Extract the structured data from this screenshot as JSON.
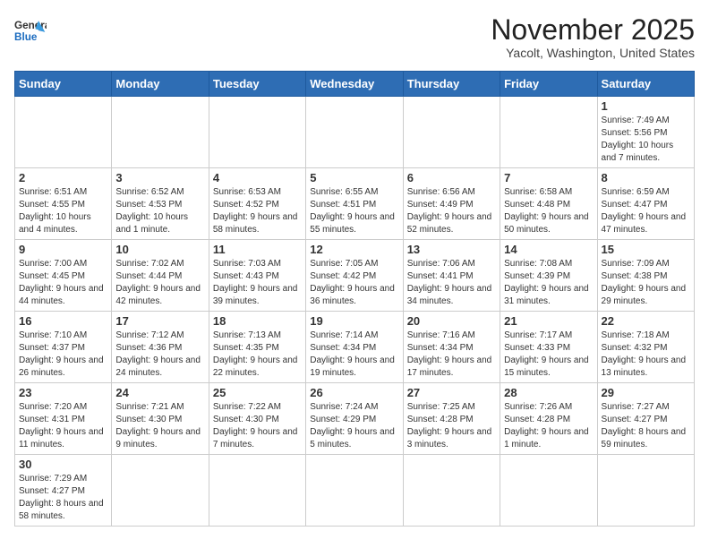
{
  "header": {
    "logo_general": "General",
    "logo_blue": "Blue",
    "month": "November 2025",
    "location": "Yacolt, Washington, United States"
  },
  "weekdays": [
    "Sunday",
    "Monday",
    "Tuesday",
    "Wednesday",
    "Thursday",
    "Friday",
    "Saturday"
  ],
  "weeks": [
    [
      {
        "day": "",
        "info": ""
      },
      {
        "day": "",
        "info": ""
      },
      {
        "day": "",
        "info": ""
      },
      {
        "day": "",
        "info": ""
      },
      {
        "day": "",
        "info": ""
      },
      {
        "day": "",
        "info": ""
      },
      {
        "day": "1",
        "info": "Sunrise: 7:49 AM\nSunset: 5:56 PM\nDaylight: 10 hours and 7 minutes."
      }
    ],
    [
      {
        "day": "2",
        "info": "Sunrise: 6:51 AM\nSunset: 4:55 PM\nDaylight: 10 hours and 4 minutes."
      },
      {
        "day": "3",
        "info": "Sunrise: 6:52 AM\nSunset: 4:53 PM\nDaylight: 10 hours and 1 minute."
      },
      {
        "day": "4",
        "info": "Sunrise: 6:53 AM\nSunset: 4:52 PM\nDaylight: 9 hours and 58 minutes."
      },
      {
        "day": "5",
        "info": "Sunrise: 6:55 AM\nSunset: 4:51 PM\nDaylight: 9 hours and 55 minutes."
      },
      {
        "day": "6",
        "info": "Sunrise: 6:56 AM\nSunset: 4:49 PM\nDaylight: 9 hours and 52 minutes."
      },
      {
        "day": "7",
        "info": "Sunrise: 6:58 AM\nSunset: 4:48 PM\nDaylight: 9 hours and 50 minutes."
      },
      {
        "day": "8",
        "info": "Sunrise: 6:59 AM\nSunset: 4:47 PM\nDaylight: 9 hours and 47 minutes."
      }
    ],
    [
      {
        "day": "9",
        "info": "Sunrise: 7:00 AM\nSunset: 4:45 PM\nDaylight: 9 hours and 44 minutes."
      },
      {
        "day": "10",
        "info": "Sunrise: 7:02 AM\nSunset: 4:44 PM\nDaylight: 9 hours and 42 minutes."
      },
      {
        "day": "11",
        "info": "Sunrise: 7:03 AM\nSunset: 4:43 PM\nDaylight: 9 hours and 39 minutes."
      },
      {
        "day": "12",
        "info": "Sunrise: 7:05 AM\nSunset: 4:42 PM\nDaylight: 9 hours and 36 minutes."
      },
      {
        "day": "13",
        "info": "Sunrise: 7:06 AM\nSunset: 4:41 PM\nDaylight: 9 hours and 34 minutes."
      },
      {
        "day": "14",
        "info": "Sunrise: 7:08 AM\nSunset: 4:39 PM\nDaylight: 9 hours and 31 minutes."
      },
      {
        "day": "15",
        "info": "Sunrise: 7:09 AM\nSunset: 4:38 PM\nDaylight: 9 hours and 29 minutes."
      }
    ],
    [
      {
        "day": "16",
        "info": "Sunrise: 7:10 AM\nSunset: 4:37 PM\nDaylight: 9 hours and 26 minutes."
      },
      {
        "day": "17",
        "info": "Sunrise: 7:12 AM\nSunset: 4:36 PM\nDaylight: 9 hours and 24 minutes."
      },
      {
        "day": "18",
        "info": "Sunrise: 7:13 AM\nSunset: 4:35 PM\nDaylight: 9 hours and 22 minutes."
      },
      {
        "day": "19",
        "info": "Sunrise: 7:14 AM\nSunset: 4:34 PM\nDaylight: 9 hours and 19 minutes."
      },
      {
        "day": "20",
        "info": "Sunrise: 7:16 AM\nSunset: 4:34 PM\nDaylight: 9 hours and 17 minutes."
      },
      {
        "day": "21",
        "info": "Sunrise: 7:17 AM\nSunset: 4:33 PM\nDaylight: 9 hours and 15 minutes."
      },
      {
        "day": "22",
        "info": "Sunrise: 7:18 AM\nSunset: 4:32 PM\nDaylight: 9 hours and 13 minutes."
      }
    ],
    [
      {
        "day": "23",
        "info": "Sunrise: 7:20 AM\nSunset: 4:31 PM\nDaylight: 9 hours and 11 minutes."
      },
      {
        "day": "24",
        "info": "Sunrise: 7:21 AM\nSunset: 4:30 PM\nDaylight: 9 hours and 9 minutes."
      },
      {
        "day": "25",
        "info": "Sunrise: 7:22 AM\nSunset: 4:30 PM\nDaylight: 9 hours and 7 minutes."
      },
      {
        "day": "26",
        "info": "Sunrise: 7:24 AM\nSunset: 4:29 PM\nDaylight: 9 hours and 5 minutes."
      },
      {
        "day": "27",
        "info": "Sunrise: 7:25 AM\nSunset: 4:28 PM\nDaylight: 9 hours and 3 minutes."
      },
      {
        "day": "28",
        "info": "Sunrise: 7:26 AM\nSunset: 4:28 PM\nDaylight: 9 hours and 1 minute."
      },
      {
        "day": "29",
        "info": "Sunrise: 7:27 AM\nSunset: 4:27 PM\nDaylight: 8 hours and 59 minutes."
      }
    ],
    [
      {
        "day": "30",
        "info": "Sunrise: 7:29 AM\nSunset: 4:27 PM\nDaylight: 8 hours and 58 minutes."
      },
      {
        "day": "",
        "info": ""
      },
      {
        "day": "",
        "info": ""
      },
      {
        "day": "",
        "info": ""
      },
      {
        "day": "",
        "info": ""
      },
      {
        "day": "",
        "info": ""
      },
      {
        "day": "",
        "info": ""
      }
    ]
  ]
}
